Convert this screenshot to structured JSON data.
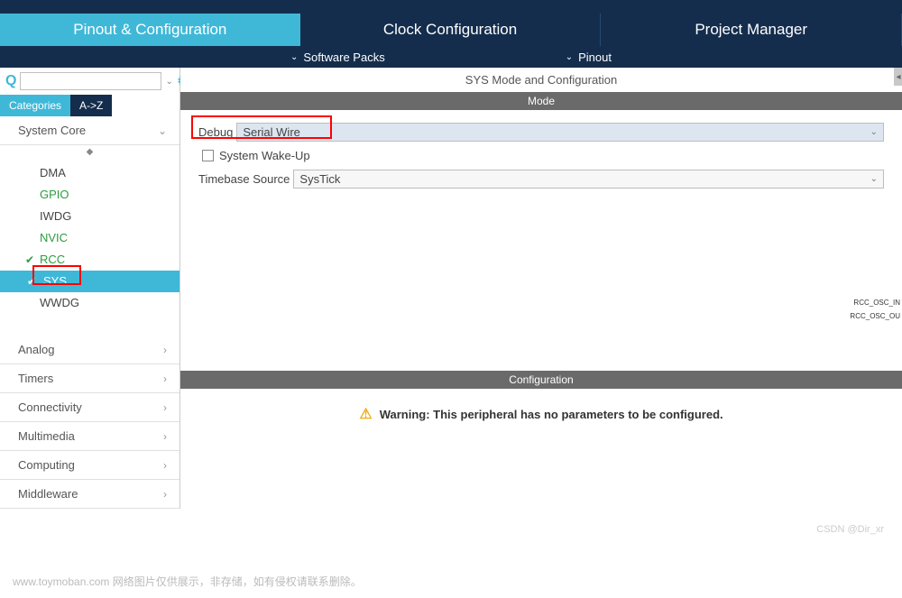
{
  "mainTabs": {
    "pinout": "Pinout & Configuration",
    "clock": "Clock Configuration",
    "project": "Project Manager"
  },
  "subBar": {
    "software": "Software Packs",
    "pinout": "Pinout"
  },
  "sidebar": {
    "searchPlaceholder": "",
    "tabs": {
      "categories": "Categories",
      "az": "A->Z"
    },
    "categories": {
      "systemCore": "System Core",
      "analog": "Analog",
      "timers": "Timers",
      "connectivity": "Connectivity",
      "multimedia": "Multimedia",
      "computing": "Computing",
      "middleware": "Middleware"
    },
    "systemCoreItems": {
      "dma": "DMA",
      "gpio": "GPIO",
      "iwdg": "IWDG",
      "nvic": "NVIC",
      "rcc": "RCC",
      "sys": "SYS",
      "wwdg": "WWDG"
    }
  },
  "panel": {
    "title": "SYS Mode and Configuration",
    "modeLabel": "Mode",
    "debugLabel": "Debug",
    "debugValue": "Serial Wire",
    "wakeupLabel": "System Wake-Up",
    "timebaseLabel": "Timebase Source",
    "timebaseValue": "SysTick",
    "configLabel": "Configuration",
    "warningLabel": "Warning:",
    "warningText": "This peripheral has no parameters to be configured."
  },
  "rightLabels": {
    "osc_in": "RCC_OSC_IN",
    "osc_out": "RCC_OSC_OU"
  },
  "footer": {
    "watermark": "www.toymoban.com 网络图片仅供展示，非存储，如有侵权请联系删除。",
    "attribution": "CSDN @Dir_xr"
  }
}
